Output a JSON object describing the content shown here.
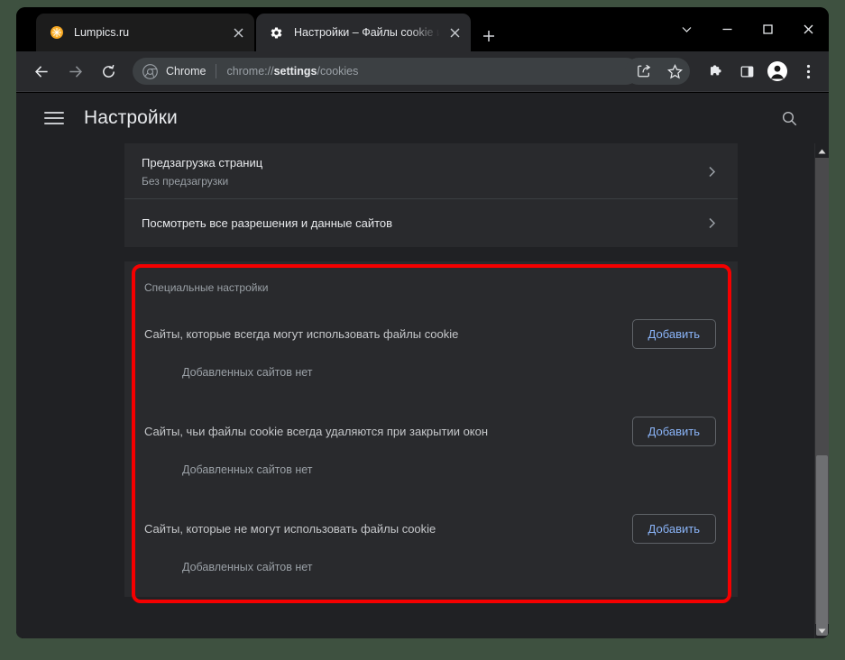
{
  "window": {
    "controls": {
      "tab_search": "tab-search-chevron",
      "minimize": "minimize",
      "maximize": "maximize",
      "close": "close"
    }
  },
  "tabs": [
    {
      "title": "Lumpics.ru",
      "favicon": "orange-slice-icon",
      "active": false,
      "truncated": false
    },
    {
      "title": "Настройки – Файлы cookie и др",
      "favicon": "gear-icon",
      "active": true,
      "truncated": true
    }
  ],
  "new_tab_label": "+",
  "toolbar": {
    "back": "back-arrow",
    "forward": "forward-arrow",
    "reload": "reload",
    "omnibox": {
      "chrome_label": "Chrome",
      "url_prefix": "chrome://",
      "url_bold": "settings",
      "url_suffix": "/cookies",
      "full_url": "chrome://settings/cookies"
    },
    "share": "share-icon",
    "bookmark": "star-icon",
    "extensions": "puzzle-icon",
    "side_panel": "side-panel-icon",
    "profile": "avatar-icon",
    "menu": "three-dot-menu-icon"
  },
  "settings_header": {
    "menu": "hamburger-icon",
    "title": "Настройки",
    "search": "search-icon"
  },
  "content": {
    "rows": [
      {
        "title": "Предзагрузка страниц",
        "sub": "Без предзагрузки"
      },
      {
        "title": "Посмотреть все разрешения и данные сайтов",
        "sub": ""
      }
    ],
    "special": {
      "heading": "Специальные настройки",
      "add_label": "Добавить",
      "empty_label": "Добавленных сайтов нет",
      "groups": [
        {
          "label": "Сайты, которые всегда могут использовать файлы cookie",
          "add": "Добавить",
          "empty": "Добавленных сайтов нет"
        },
        {
          "label": "Сайты, чьи файлы cookie всегда удаляются при закрытии окон",
          "add": "Добавить",
          "empty": "Добавленных сайтов нет"
        },
        {
          "label": "Сайты, которые не могут использовать файлы cookie",
          "add": "Добавить",
          "empty": "Добавленных сайтов нет"
        }
      ]
    }
  },
  "colors": {
    "highlight_box": "#f50000",
    "accent_link": "#8ab4f8",
    "page_bg": "#202124",
    "card_bg": "#292a2d",
    "toolbar_bg": "#292a2d",
    "tabstrip_bg": "#000000",
    "desktop_bg": "#3e5140"
  }
}
